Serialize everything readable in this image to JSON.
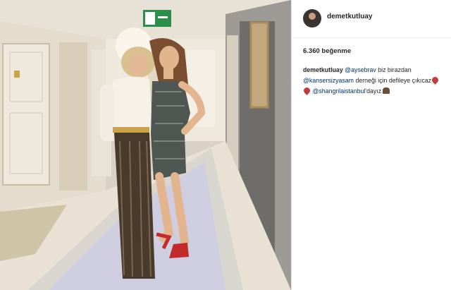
{
  "photo": {
    "exit_sign": "EXIT"
  },
  "post": {
    "username": "demetkutluay",
    "likes": "6.360 beğenme",
    "caption": {
      "author": "demetkutluay",
      "mention_1": "@aysebrav",
      "text_1": " biz birazdan ",
      "mention_2": "@kansersizyasam",
      "text_2": " derneği için defileye çıkıcaz",
      "mention_3": "@shangrilaistanbul",
      "text_3": "'dayız"
    }
  },
  "icons": [
    "profile-avatar",
    "heart-emoji",
    "woman-emoji",
    "exit-sign-icon"
  ]
}
